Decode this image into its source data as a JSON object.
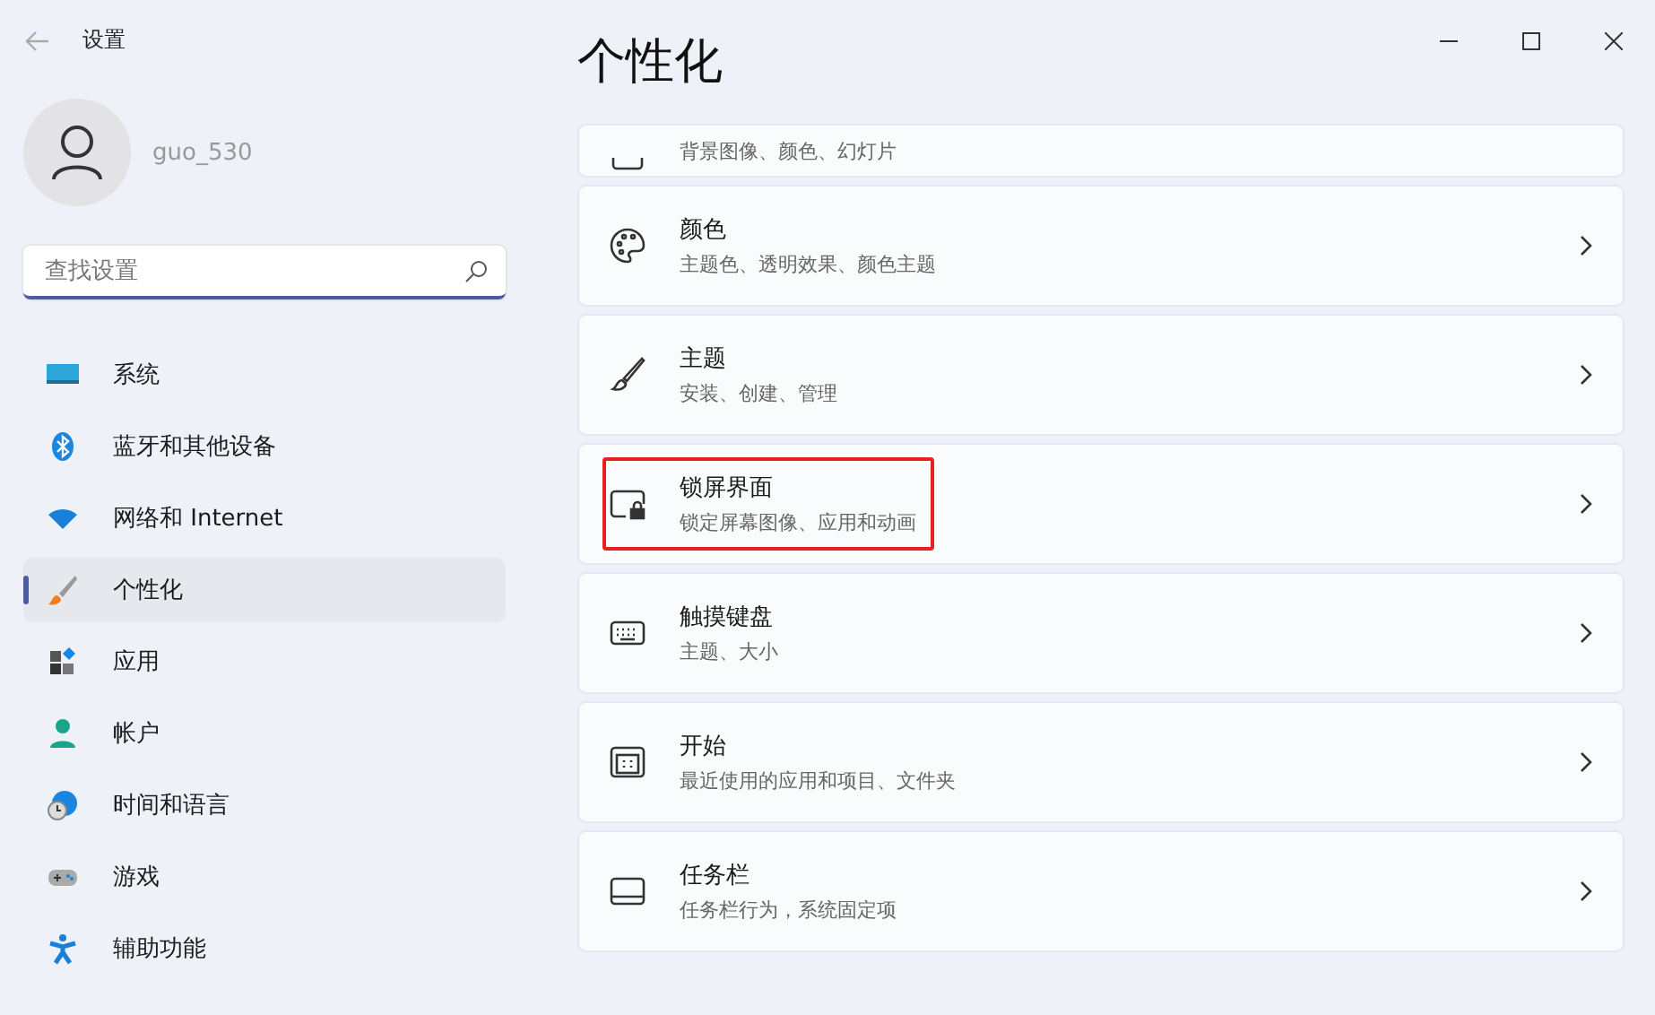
{
  "window": {
    "title": "设置"
  },
  "account": {
    "name": "guo_530"
  },
  "search": {
    "placeholder": "查找设置"
  },
  "sidebar": {
    "items": [
      {
        "label": "系统",
        "selected": false
      },
      {
        "label": "蓝牙和其他设备",
        "selected": false
      },
      {
        "label": "网络和 Internet",
        "selected": false
      },
      {
        "label": "个性化",
        "selected": true
      },
      {
        "label": "应用",
        "selected": false
      },
      {
        "label": "帐户",
        "selected": false
      },
      {
        "label": "时间和语言",
        "selected": false
      },
      {
        "label": "游戏",
        "selected": false
      },
      {
        "label": "辅助功能",
        "selected": false
      }
    ]
  },
  "page": {
    "title": "个性化",
    "cards": [
      {
        "kind": "partial",
        "subtitle": "背景图像、颜色、幻灯片",
        "highlighted": false
      },
      {
        "kind": "full",
        "title": "颜色",
        "subtitle": "主题色、透明效果、颜色主题",
        "highlighted": false
      },
      {
        "kind": "full",
        "title": "主题",
        "subtitle": "安装、创建、管理",
        "highlighted": false
      },
      {
        "kind": "full",
        "title": "锁屏界面",
        "subtitle": "锁定屏幕图像、应用和动画",
        "highlighted": true
      },
      {
        "kind": "full",
        "title": "触摸键盘",
        "subtitle": "主题、大小",
        "highlighted": false
      },
      {
        "kind": "full",
        "title": "开始",
        "subtitle": "最近使用的应用和项目、文件夹",
        "highlighted": false
      },
      {
        "kind": "full",
        "title": "任务栏",
        "subtitle": "任务栏行为，系统固定项",
        "highlighted": false
      }
    ]
  }
}
